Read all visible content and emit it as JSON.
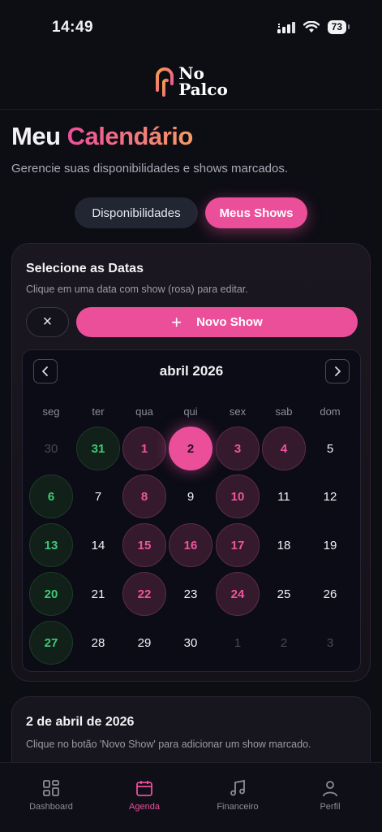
{
  "status": {
    "time": "14:49",
    "battery": "73"
  },
  "brand": {
    "name_line1": "No",
    "name_line2": "Palco"
  },
  "page": {
    "title_plain": "Meu",
    "title_accent": "Calendário",
    "subtitle": "Gerencie suas disponibilidades e shows marcados."
  },
  "segments": {
    "availability": "Disponibilidades",
    "my_shows": "Meus Shows",
    "active": "my_shows"
  },
  "selector": {
    "title": "Selecione as Datas",
    "hint": "Clique em uma data com show (rosa) para editar.",
    "clear_label": "×",
    "new_show_label": "Novo Show"
  },
  "calendar": {
    "month_label": "abril 2026",
    "weekdays": [
      "seg",
      "ter",
      "qua",
      "qui",
      "sex",
      "sab",
      "dom"
    ],
    "days": [
      {
        "d": "30",
        "s": "muted"
      },
      {
        "d": "31",
        "s": "avail"
      },
      {
        "d": "1",
        "s": "show"
      },
      {
        "d": "2",
        "s": "sel"
      },
      {
        "d": "3",
        "s": "show"
      },
      {
        "d": "4",
        "s": "show"
      },
      {
        "d": "5",
        "s": ""
      },
      {
        "d": "6",
        "s": "avail"
      },
      {
        "d": "7",
        "s": ""
      },
      {
        "d": "8",
        "s": "show"
      },
      {
        "d": "9",
        "s": ""
      },
      {
        "d": "10",
        "s": "show"
      },
      {
        "d": "11",
        "s": ""
      },
      {
        "d": "12",
        "s": ""
      },
      {
        "d": "13",
        "s": "avail"
      },
      {
        "d": "14",
        "s": ""
      },
      {
        "d": "15",
        "s": "show"
      },
      {
        "d": "16",
        "s": "show"
      },
      {
        "d": "17",
        "s": "show"
      },
      {
        "d": "18",
        "s": ""
      },
      {
        "d": "19",
        "s": ""
      },
      {
        "d": "20",
        "s": "avail"
      },
      {
        "d": "21",
        "s": ""
      },
      {
        "d": "22",
        "s": "show"
      },
      {
        "d": "23",
        "s": ""
      },
      {
        "d": "24",
        "s": "show"
      },
      {
        "d": "25",
        "s": ""
      },
      {
        "d": "26",
        "s": ""
      },
      {
        "d": "27",
        "s": "avail"
      },
      {
        "d": "28",
        "s": ""
      },
      {
        "d": "29",
        "s": ""
      },
      {
        "d": "30",
        "s": ""
      },
      {
        "d": "1",
        "s": "muted"
      },
      {
        "d": "2",
        "s": "muted"
      },
      {
        "d": "3",
        "s": "muted"
      }
    ]
  },
  "details": {
    "title": "2 de abril de 2026",
    "hint": "Clique no botão 'Novo Show' para adicionar um show marcado."
  },
  "tabs": [
    {
      "label": "Dashboard",
      "icon": "dashboard-icon",
      "active": false
    },
    {
      "label": "Agenda",
      "icon": "calendar-icon",
      "active": true
    },
    {
      "label": "Financeiro",
      "icon": "music-note-icon",
      "active": false
    },
    {
      "label": "Perfil",
      "icon": "user-icon",
      "active": false
    }
  ],
  "colors": {
    "accent": "#ec4f9a",
    "available": "#3fcb78",
    "background": "#0d0d14"
  }
}
